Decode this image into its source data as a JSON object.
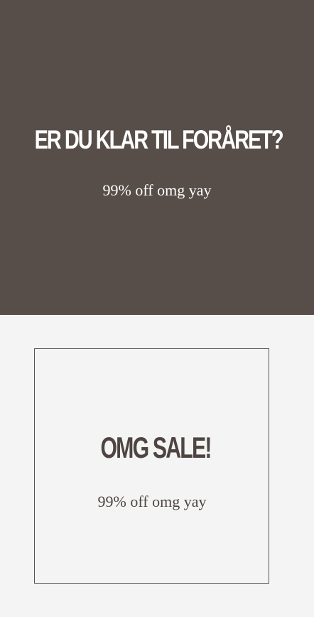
{
  "hero": {
    "title": "ER DU KLAR TIL FORÅRET?",
    "subtitle": "99% off omg yay"
  },
  "sale": {
    "title": "OMG SALE!",
    "subtitle": "99% off omg yay"
  },
  "colors": {
    "hero_background": "#574e49",
    "page_background": "#f4f4f4",
    "sale_text": "#4e4542",
    "hero_text": "#ffffff"
  }
}
